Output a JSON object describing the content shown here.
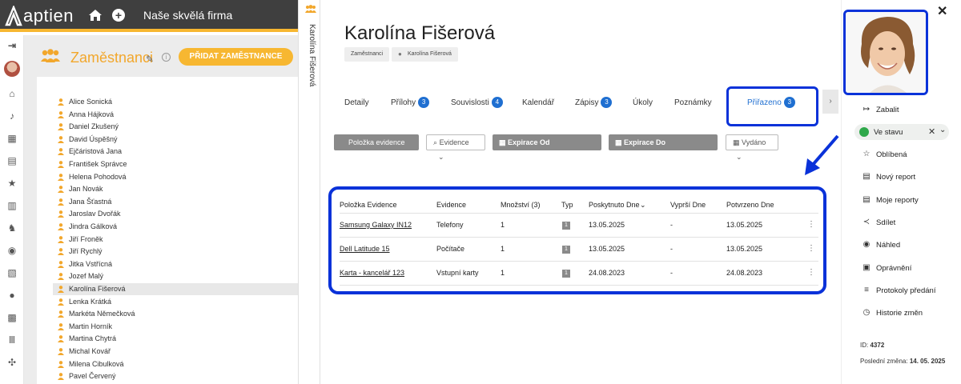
{
  "topbar": {
    "brand": "aptien",
    "company": "Naše skvělá firma"
  },
  "employees_panel": {
    "title": "Zaměstnanci",
    "add_button": "PŘIDAT ZAMĚSTNANCE",
    "items": [
      "Alice Sonická",
      "Anna Hájková",
      "Daniel Zkušený",
      "David Úspěšný",
      "Ejčáristová Jana",
      "František Správce",
      "Helena Pohodová",
      "Jan Novák",
      "Jana Šťastná",
      "Jaroslav Dvořák",
      "Jindra Gálková",
      "Jiří Froněk",
      "Jiří Rychlý",
      "Jitka Vstřícná",
      "Jozef Malý",
      "Karolína Fišerová",
      "Lenka Krátká",
      "Markéta Němečková",
      "Martin Horník",
      "Martina Chytrá",
      "Michal Kovář",
      "Milena Cibulková",
      "Pavel Červený"
    ],
    "selected": "Karolína Fišerová"
  },
  "vertical_tab": {
    "label": "Karolína Fišerová"
  },
  "detail": {
    "name": "Karolína Fišerová",
    "breadcrumb": [
      "Zaměstnanci",
      "Karolína Fišerová"
    ],
    "tabs": [
      {
        "label": "Detaily",
        "badge": ""
      },
      {
        "label": "Přílohy",
        "badge": "3"
      },
      {
        "label": "Souvislosti",
        "badge": "4"
      },
      {
        "label": "Kalendář",
        "badge": ""
      },
      {
        "label": "Zápisy",
        "badge": "3"
      },
      {
        "label": "Úkoly",
        "badge": ""
      },
      {
        "label": "Poznámky",
        "badge": ""
      },
      {
        "label": "Přiřazeno",
        "badge": "3",
        "active": true
      }
    ],
    "filters": {
      "item": "Položka evidence",
      "evidence": "Evidence",
      "expiry_from": "Expirace Od",
      "expiry_to": "Expirace Do",
      "issued": "Vydáno"
    },
    "table": {
      "headers": [
        "Položka Evidence",
        "Evidence",
        "Množství (3)",
        "Typ",
        "Poskytnuto Dne",
        "Vyprší Dne",
        "Potvrzeno Dne"
      ],
      "rows": [
        {
          "item": "Samsung Galaxy IN12",
          "evidence": "Telefony",
          "qty": "1",
          "type": "1",
          "provided": "13.05.2025",
          "expires": "-",
          "confirmed": "13.05.2025"
        },
        {
          "item": "Dell Latitude 15",
          "evidence": "Počítače",
          "qty": "1",
          "type": "1",
          "provided": "13.05.2025",
          "expires": "-",
          "confirmed": "13.05.2025"
        },
        {
          "item": "Karta - kancelář 123",
          "evidence": "Vstupní karty",
          "qty": "1",
          "type": "1",
          "provided": "24.08.2023",
          "expires": "-",
          "confirmed": "24.08.2023"
        }
      ]
    }
  },
  "right_panel": {
    "collapse": "Zabalit",
    "status": "Ve stavu",
    "actions": [
      "Oblíbená",
      "Nový report",
      "Moje reporty",
      "Sdílet",
      "Náhled",
      "Oprávnění",
      "Protokoly předání",
      "Historie změn"
    ],
    "id_label": "ID:",
    "id_value": "4372",
    "last_change_label": "Poslední změna:",
    "last_change_value": "14. 05. 2025"
  },
  "colors": {
    "accent": "#f7b731",
    "highlight": "#0a32d9",
    "badge": "#1f6fd1",
    "status": "#2ea84a"
  }
}
